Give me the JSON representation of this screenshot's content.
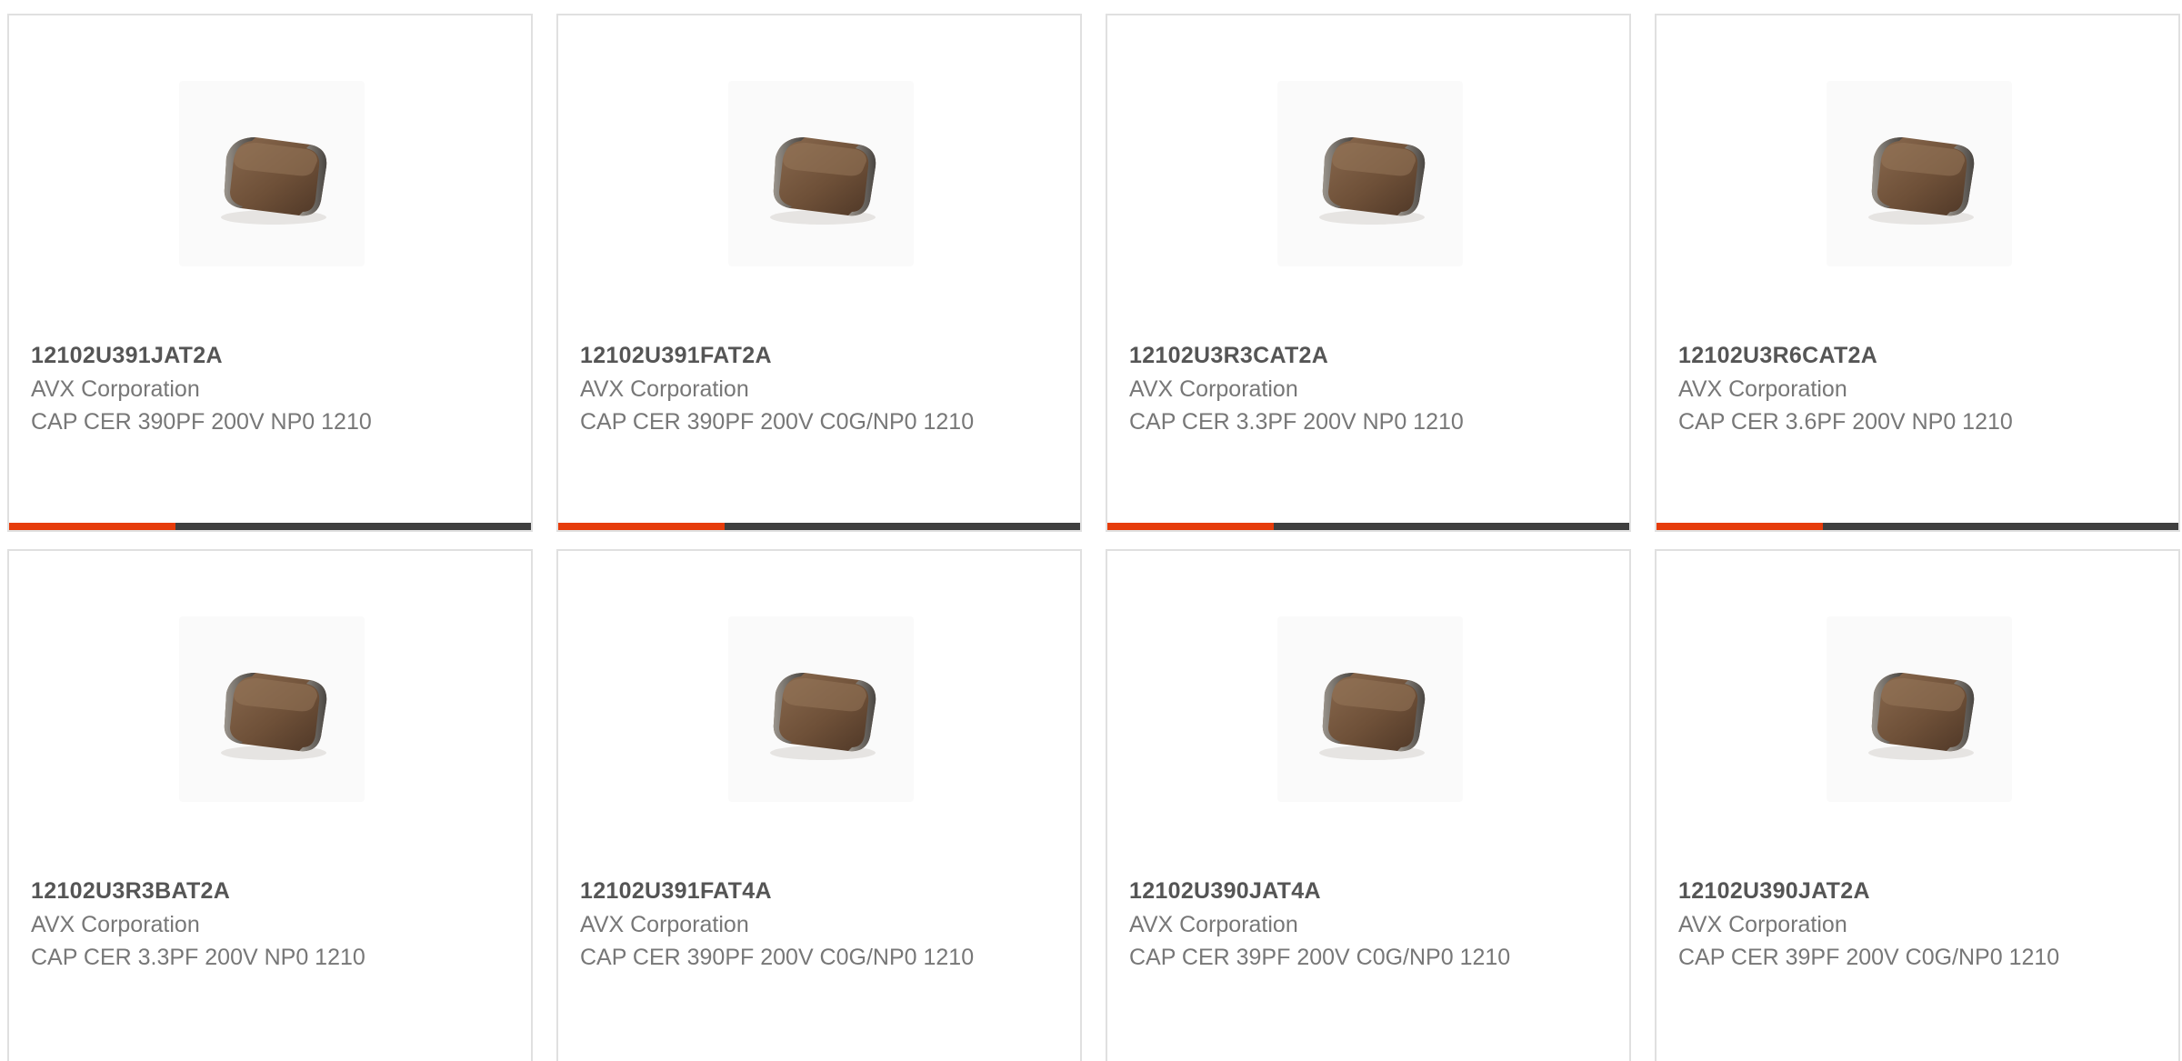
{
  "colors": {
    "accent": "#e63c0b",
    "bar": "#3f3f3f",
    "border": "#e0e0e0",
    "title_text": "#555555",
    "body_text": "#777777"
  },
  "products": [
    {
      "part_number": "12102U391JAT2A",
      "manufacturer": "AVX Corporation",
      "description": "CAP CER 390PF 200V NP0 1210",
      "image_icon": "ceramic-capacitor-chip-icon"
    },
    {
      "part_number": "12102U391FAT2A",
      "manufacturer": "AVX Corporation",
      "description": "CAP CER 390PF 200V C0G/NP0 1210",
      "image_icon": "ceramic-capacitor-chip-icon"
    },
    {
      "part_number": "12102U3R3CAT2A",
      "manufacturer": "AVX Corporation",
      "description": "CAP CER 3.3PF 200V NP0 1210",
      "image_icon": "ceramic-capacitor-chip-icon"
    },
    {
      "part_number": "12102U3R6CAT2A",
      "manufacturer": "AVX Corporation",
      "description": "CAP CER 3.6PF 200V NP0 1210",
      "image_icon": "ceramic-capacitor-chip-icon"
    },
    {
      "part_number": "12102U3R3BAT2A",
      "manufacturer": "AVX Corporation",
      "description": "CAP CER 3.3PF 200V NP0 1210",
      "image_icon": "ceramic-capacitor-chip-icon"
    },
    {
      "part_number": "12102U391FAT4A",
      "manufacturer": "AVX Corporation",
      "description": "CAP CER 390PF 200V C0G/NP0 1210",
      "image_icon": "ceramic-capacitor-chip-icon"
    },
    {
      "part_number": "12102U390JAT4A",
      "manufacturer": "AVX Corporation",
      "description": "CAP CER 39PF 200V C0G/NP0 1210",
      "image_icon": "ceramic-capacitor-chip-icon"
    },
    {
      "part_number": "12102U390JAT2A",
      "manufacturer": "AVX Corporation",
      "description": "CAP CER 39PF 200V C0G/NP0 1210",
      "image_icon": "ceramic-capacitor-chip-icon"
    }
  ]
}
